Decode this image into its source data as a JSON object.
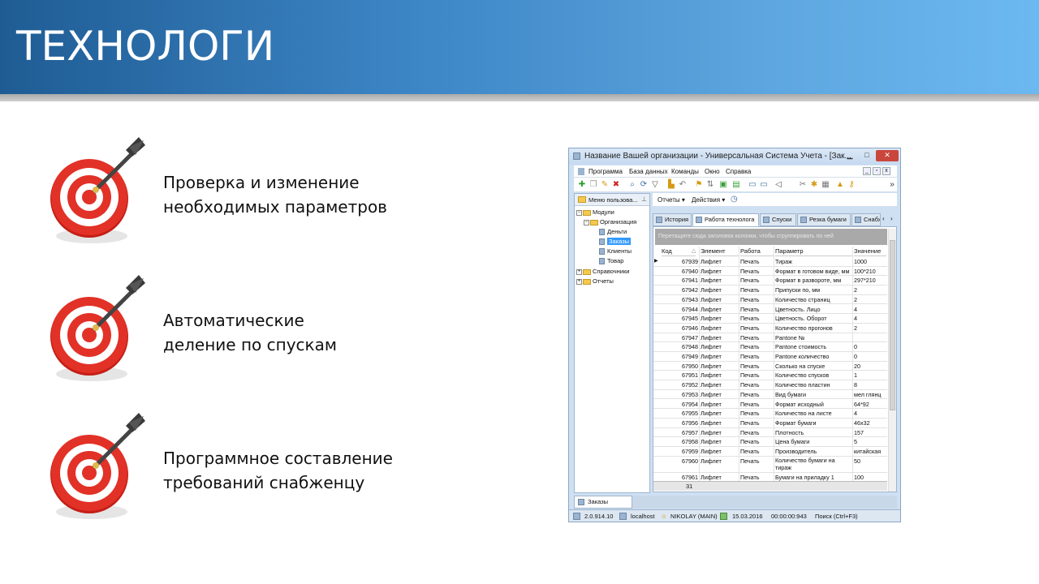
{
  "slide": {
    "title": "ТЕХНОЛОГИ",
    "bullets": [
      {
        "line1": "Проверка и изменение",
        "line2": "необходимых параметров",
        "icon": "target-dart-icon"
      },
      {
        "line1": "Автоматические",
        "line2": "деление по спускам",
        "icon": "target-dart-icon"
      },
      {
        "line1": "Программное составление",
        "line2": "требований снабженцу",
        "icon": "target-dart-icon"
      }
    ]
  },
  "app": {
    "window_title": "Название Вашей организации - Универсальная Система Учета - [Зак...",
    "menu": [
      "Программа",
      "База данных",
      "Команды",
      "Окно",
      "Справка"
    ],
    "left_panel": {
      "header": "Меню пользова...",
      "tree": [
        {
          "label": "Модули",
          "level": 0,
          "type": "folder",
          "toggle": "−"
        },
        {
          "label": "Организация",
          "level": 1,
          "type": "folder",
          "toggle": "−"
        },
        {
          "label": "Деньги",
          "level": 2,
          "type": "doc"
        },
        {
          "label": "Заказы",
          "level": 2,
          "type": "doc",
          "selected": true
        },
        {
          "label": "Клиенты",
          "level": 2,
          "type": "doc"
        },
        {
          "label": "Товар",
          "level": 2,
          "type": "doc"
        },
        {
          "label": "Справочники",
          "level": 0,
          "type": "folder",
          "toggle": "+"
        },
        {
          "label": "Отчеты",
          "level": 0,
          "type": "folder",
          "toggle": "+"
        }
      ]
    },
    "subbar": {
      "reports": "Отчеты ▾",
      "actions": "Действия ▾"
    },
    "tabs": [
      "История",
      "Работа технолога",
      "Спуски",
      "Резка бумаги",
      "Снабж"
    ],
    "active_tab": 1,
    "grid": {
      "group_hint": "Перетащите сюда заголовок колонки, чтобы сгруппировать по ней",
      "columns": [
        "Код",
        "Элемент",
        "Работа",
        "Параметр",
        "Значение"
      ],
      "rows": [
        [
          "67939",
          "Лифлет",
          "Печать",
          "Тираж",
          "1000"
        ],
        [
          "67940",
          "Лифлет",
          "Печать",
          "Формат в готовом виде, мм",
          "100*210"
        ],
        [
          "67941",
          "Лифлет",
          "Печать",
          "Формат в развороте, мм",
          "297*210"
        ],
        [
          "67942",
          "Лифлет",
          "Печать",
          "Припуски по, мм",
          "2"
        ],
        [
          "67943",
          "Лифлет",
          "Печать",
          "Количество страниц",
          "2"
        ],
        [
          "67944",
          "Лифлет",
          "Печать",
          "Цветность. Лицо",
          "4"
        ],
        [
          "67945",
          "Лифлет",
          "Печать",
          "Цветность. Оборот",
          "4"
        ],
        [
          "67946",
          "Лифлет",
          "Печать",
          "Количество прогонов",
          "2"
        ],
        [
          "67947",
          "Лифлет",
          "Печать",
          "Pantone №",
          ""
        ],
        [
          "67948",
          "Лифлет",
          "Печать",
          "Pantone стоимость",
          "0"
        ],
        [
          "67949",
          "Лифлет",
          "Печать",
          "Pantone количество",
          "0"
        ],
        [
          "67950",
          "Лифлет",
          "Печать",
          "Сколько на спуске",
          "20"
        ],
        [
          "67951",
          "Лифлет",
          "Печать",
          "Количество спусков",
          "1"
        ],
        [
          "67952",
          "Лифлет",
          "Печать",
          "Количество пластин",
          "8"
        ],
        [
          "67953",
          "Лифлет",
          "Печать",
          "Вид бумаги",
          "мел глянц"
        ],
        [
          "67954",
          "Лифлет",
          "Печать",
          "Формат исходный",
          "64*92"
        ],
        [
          "67955",
          "Лифлет",
          "Печать",
          "Количество на листе",
          "4"
        ],
        [
          "67956",
          "Лифлет",
          "Печать",
          "Формат бумаги",
          "46x32"
        ],
        [
          "67957",
          "Лифлет",
          "Печать",
          "Плотность",
          "157"
        ],
        [
          "67958",
          "Лифлет",
          "Печать",
          "Цена бумаги",
          "5"
        ],
        [
          "67959",
          "Лифлет",
          "Печать",
          "Производитель",
          "китайская"
        ],
        [
          "67960",
          "Лифлет",
          "Печать",
          "Количество бумаги на тираж",
          "50"
        ],
        [
          "67961",
          "Лифлет",
          "Печать",
          "Бумаги на приладку 1",
          "100"
        ]
      ],
      "footer_count": "31"
    },
    "bottom_tab": "Заказы",
    "status": {
      "version": "2.0.914.10",
      "host": "localhost",
      "user": "NIKOLAY (MAIN)",
      "date": "15.03.2016",
      "timer": "00:00:00:943",
      "search": "Поиск (Ctrl+F3)"
    }
  },
  "colors": {
    "header_dark": "#1f5c94",
    "header_light": "#6cb8f0",
    "target_red": "#d9261c",
    "selection": "#3399ff"
  }
}
